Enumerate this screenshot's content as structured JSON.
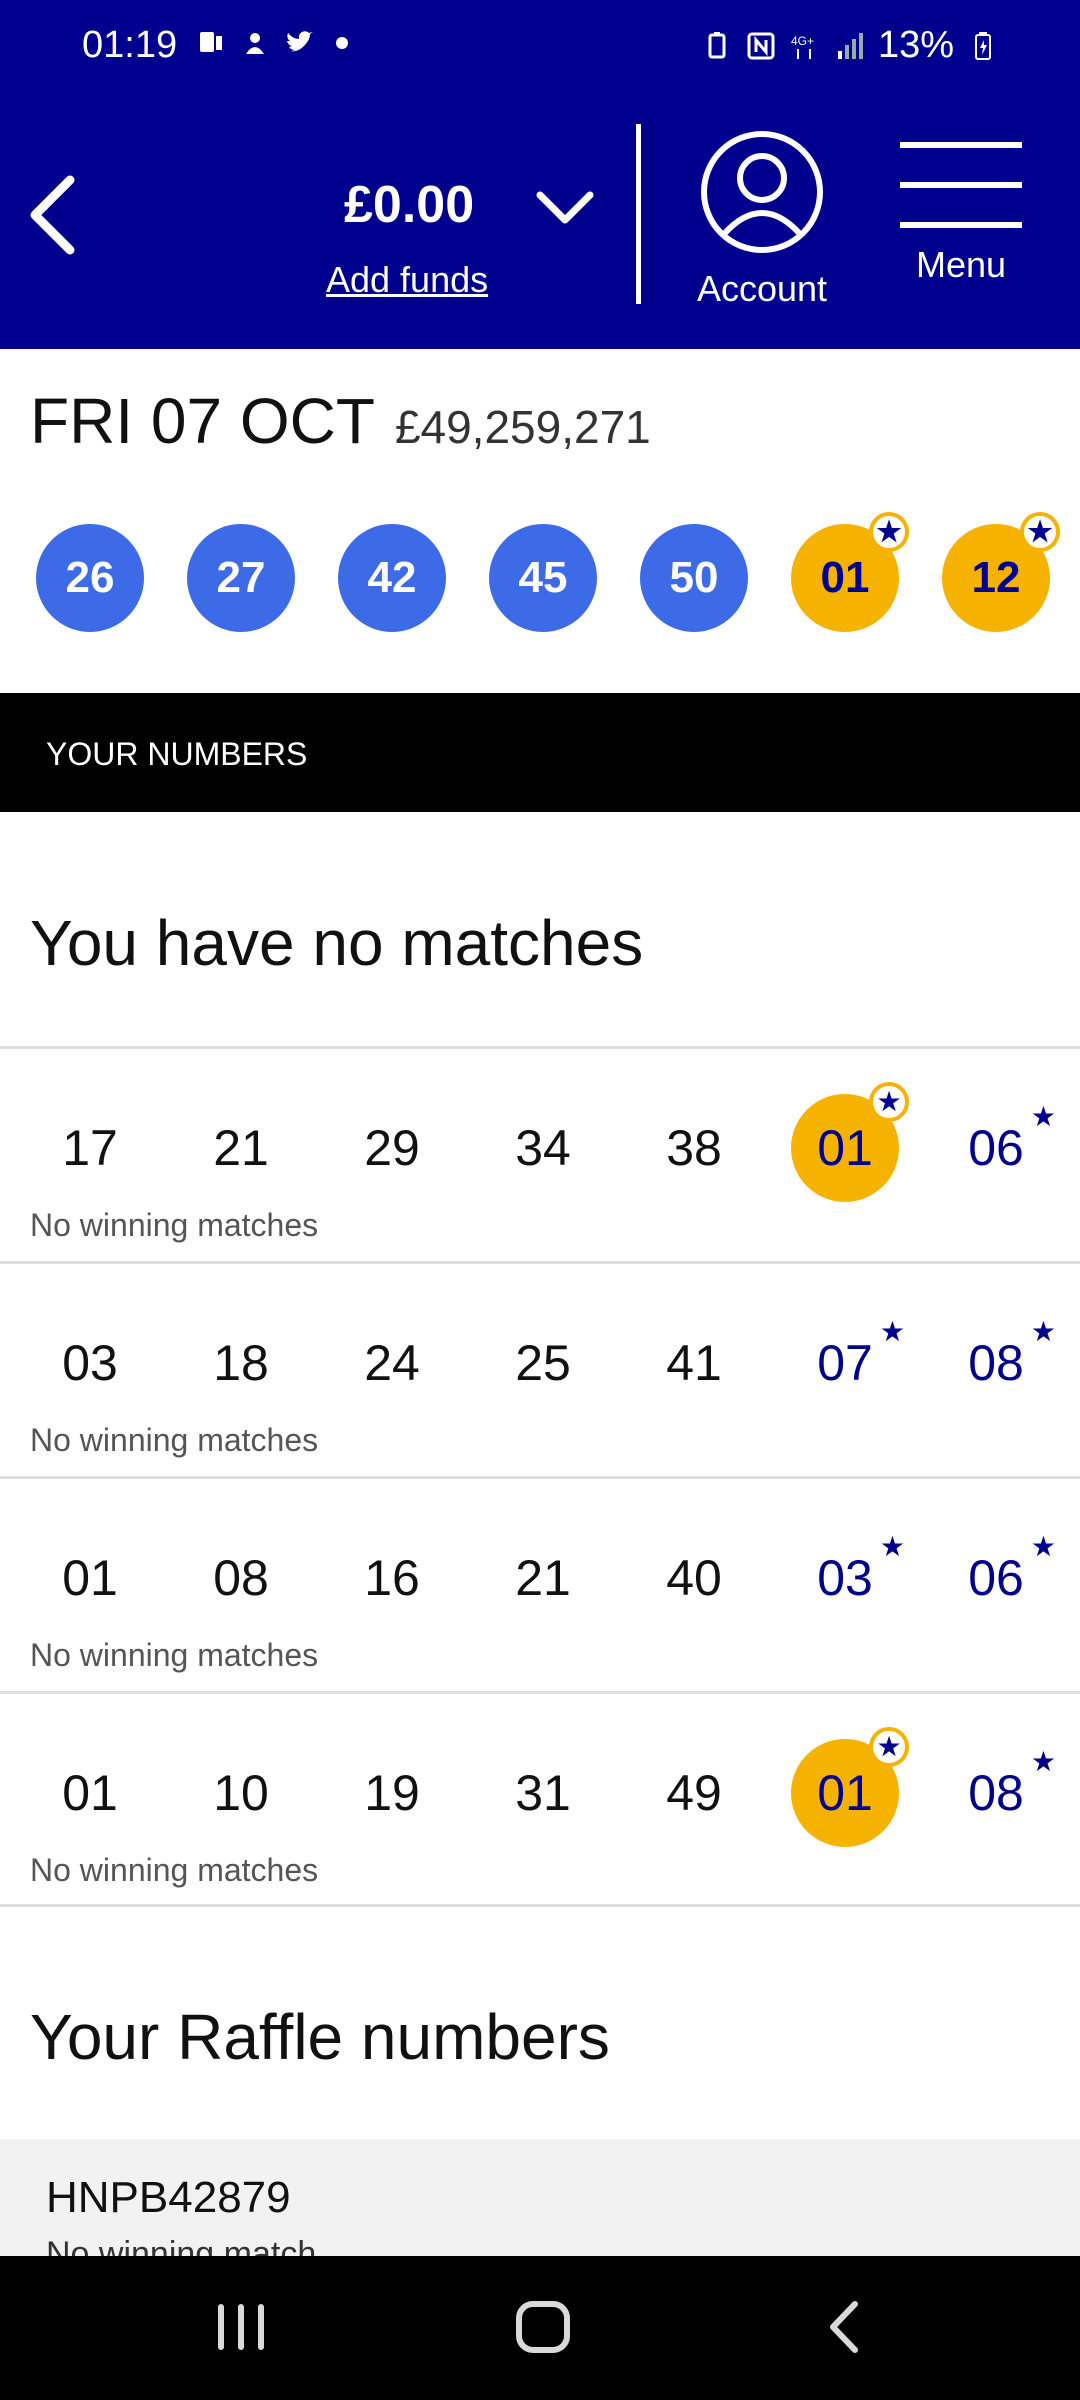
{
  "status_bar": {
    "time": "01:19",
    "battery": "13%",
    "left_icons": [
      "phone-icon",
      "vpn-icon",
      "twitter-icon",
      "dot-icon"
    ],
    "right_icons": [
      "battery-saver-icon",
      "nfc-icon",
      "4g-icon",
      "signal-icon",
      "battery-icon"
    ]
  },
  "header": {
    "balance": "£0.00",
    "add_funds": "Add funds",
    "account_label": "Account",
    "menu_label": "Menu",
    "color": "#00008f"
  },
  "draw": {
    "date": "FRI 07 OCT",
    "jackpot": "£49,259,271",
    "main_balls": [
      "26",
      "27",
      "42",
      "45",
      "50"
    ],
    "lucky_stars": [
      "01",
      "12"
    ]
  },
  "your_numbers_header": "YOUR NUMBERS",
  "result_heading": "You have no matches",
  "lines": [
    {
      "main": [
        "17",
        "21",
        "29",
        "34",
        "38"
      ],
      "stars": [
        {
          "n": "01",
          "matched": true
        },
        {
          "n": "06",
          "matched": false
        }
      ],
      "status": "No winning matches"
    },
    {
      "main": [
        "03",
        "18",
        "24",
        "25",
        "41"
      ],
      "stars": [
        {
          "n": "07",
          "matched": false
        },
        {
          "n": "08",
          "matched": false
        }
      ],
      "status": "No winning matches"
    },
    {
      "main": [
        "01",
        "08",
        "16",
        "21",
        "40"
      ],
      "stars": [
        {
          "n": "03",
          "matched": false
        },
        {
          "n": "06",
          "matched": false
        }
      ],
      "status": "No winning matches"
    },
    {
      "main": [
        "01",
        "10",
        "19",
        "31",
        "49"
      ],
      "stars": [
        {
          "n": "01",
          "matched": true
        },
        {
          "n": "08",
          "matched": false
        }
      ],
      "status": "No winning matches"
    }
  ],
  "raffle": {
    "title": "Your Raffle numbers",
    "code": "HNPB42879",
    "status": "No winning match"
  },
  "colors": {
    "main_ball": "#3d6ae6",
    "star_ball": "#f5b300",
    "navy": "#00008f"
  }
}
